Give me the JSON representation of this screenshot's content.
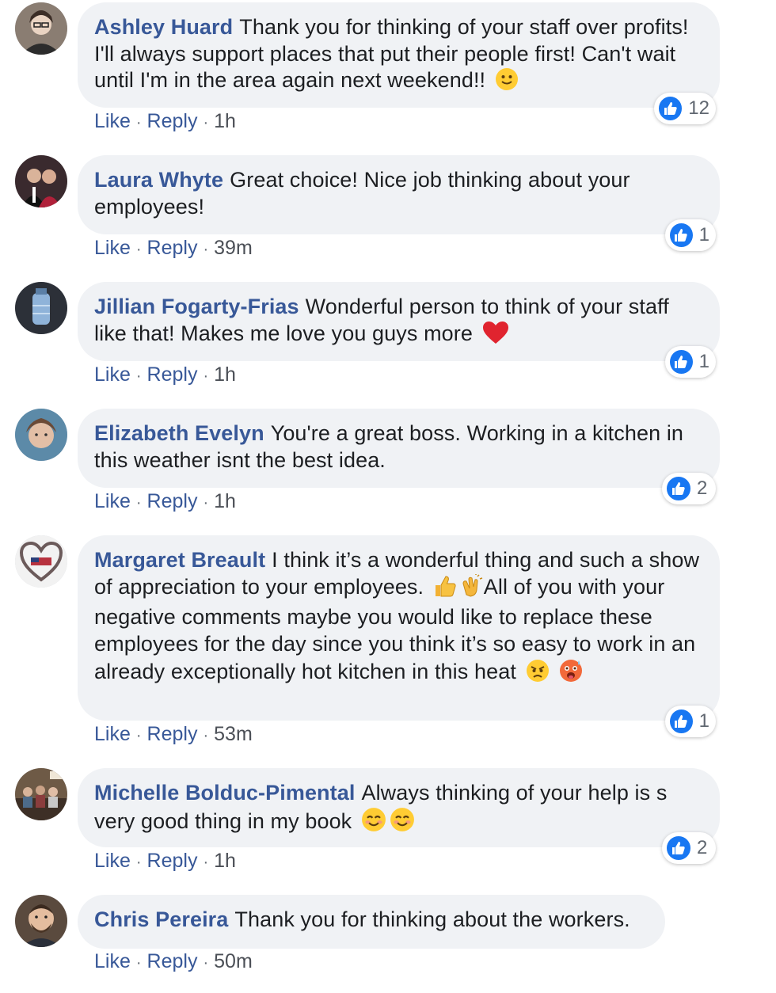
{
  "labels": {
    "like": "Like",
    "reply": "Reply",
    "dot": "·"
  },
  "colors": {
    "author": "#385898",
    "bubble": "#f0f2f5",
    "like_badge": "#1877f2"
  },
  "comments": [
    {
      "author": "Ashley Huard",
      "text": "Thank you for thinking of your staff over profits! I'll always support places that put their people first! Can't wait until I'm in the area again next weekend!!",
      "emojis": [
        "slightly-smiling-face"
      ],
      "time": "1h",
      "reactions": "12"
    },
    {
      "author": "Laura Whyte",
      "text": "Great choice! Nice job thinking about your employees!",
      "emojis": [],
      "time": "39m",
      "reactions": "1"
    },
    {
      "author": "Jillian Fogarty-Frias",
      "text": "Wonderful person to think of your staff like that! Makes me love you guys more",
      "emojis": [
        "red-heart"
      ],
      "time": "1h",
      "reactions": "1"
    },
    {
      "author": "Elizabeth Evelyn",
      "text": "You're a great boss. Working in a kitchen in this weather isnt the best idea.",
      "emojis": [],
      "time": "1h",
      "reactions": "2"
    },
    {
      "author": "Margaret Breault",
      "text_a": "I think it’s a wonderful thing and such a show of appreciation to your employees.",
      "text_b": "All of you with your negative comments maybe you would like to replace these employees for the day since you think it’s so easy to work in an already exceptionally hot kitchen in this heat",
      "emojis": [
        "thumbs-up",
        "clapping-hands",
        "angry-face",
        "hot-face"
      ],
      "time": "53m",
      "reactions": "1"
    },
    {
      "author": "Michelle Bolduc-Pimental",
      "text": "Always thinking of your help is s very good thing in my book",
      "emojis": [
        "smiling-face",
        "smiling-face"
      ],
      "time": "1h",
      "reactions": "2"
    },
    {
      "author": "Chris Pereira",
      "text": "Thank you for thinking about the workers.",
      "emojis": [],
      "time": "50m"
    }
  ]
}
